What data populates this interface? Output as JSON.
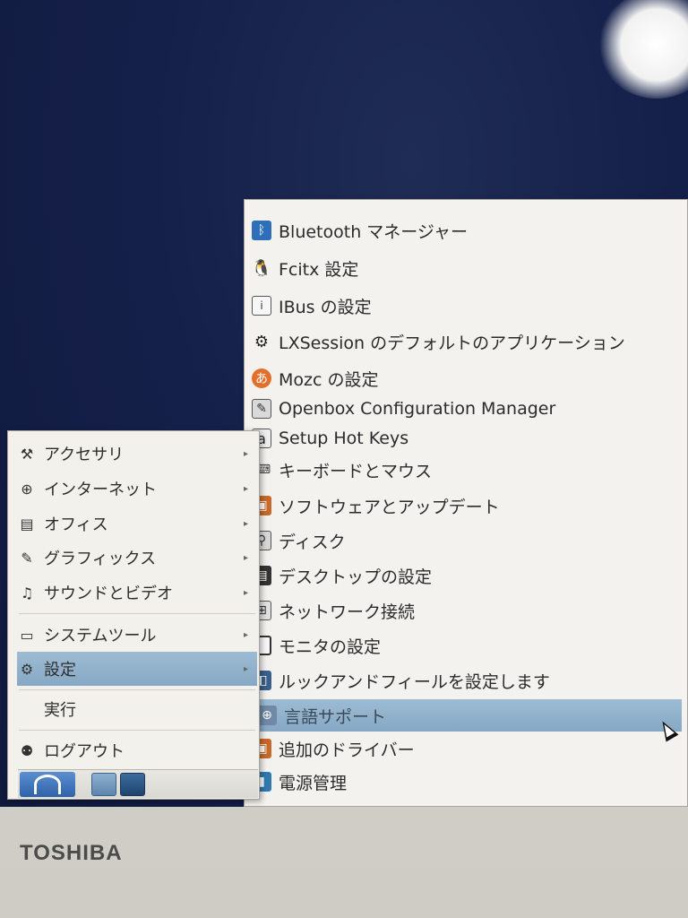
{
  "device": {
    "brand": "TOSHIBA"
  },
  "main_menu": {
    "items": [
      {
        "label": "アクセサリ",
        "icon": "accessories-icon",
        "has_submenu": true
      },
      {
        "label": "インターネット",
        "icon": "internet-globe-icon",
        "has_submenu": true
      },
      {
        "label": "オフィス",
        "icon": "office-document-icon",
        "has_submenu": true
      },
      {
        "label": "グラフィックス",
        "icon": "graphics-icon",
        "has_submenu": true
      },
      {
        "label": "サウンドとビデオ",
        "icon": "sound-video-icon",
        "has_submenu": true
      },
      {
        "label": "システムツール",
        "icon": "monitor-icon",
        "has_submenu": true
      },
      {
        "label": "設定",
        "icon": "gear-icon",
        "has_submenu": true,
        "selected": true
      },
      {
        "label": "実行",
        "icon": "",
        "has_submenu": false
      },
      {
        "label": "ログアウト",
        "icon": "logout-user-icon",
        "has_submenu": false
      }
    ],
    "submenu_arrow": "▸"
  },
  "settings_submenu": {
    "items": [
      {
        "label": "Bluetooth マネージャー",
        "icon": "bluetooth-icon"
      },
      {
        "label": "Fcitx 設定",
        "icon": "fcitx-penguin-icon"
      },
      {
        "label": "IBus の設定",
        "icon": "ibus-info-icon"
      },
      {
        "label": "LXSession のデフォルトのアプリケーション",
        "icon": "gear-icon"
      },
      {
        "label": "Mozc の設定",
        "icon": "mozc-icon"
      },
      {
        "label": "Openbox Configuration Manager",
        "icon": "openbox-icon"
      },
      {
        "label": "Setup Hot Keys",
        "icon": "hotkeys-icon"
      },
      {
        "label": "キーボードとマウス",
        "icon": "keyboard-icon"
      },
      {
        "label": "ソフトウェアとアップデート",
        "icon": "software-update-icon"
      },
      {
        "label": "ディスク",
        "icon": "disk-icon"
      },
      {
        "label": "デスクトップの設定",
        "icon": "desktop-icon"
      },
      {
        "label": "ネットワーク接続",
        "icon": "network-icon"
      },
      {
        "label": "モニタの設定",
        "icon": "monitor-icon"
      },
      {
        "label": "ルックアンドフィールを設定します",
        "icon": "look-and-feel-icon"
      },
      {
        "label": "言語サポート",
        "icon": "language-support-icon",
        "selected": true
      },
      {
        "label": "追加のドライバー",
        "icon": "additional-drivers-icon"
      },
      {
        "label": "電源管理",
        "icon": "power-management-icon"
      }
    ]
  },
  "colors": {
    "desktop_background": "#15204a",
    "menu_background": "#f2f1ec",
    "selection": "#8faecb"
  }
}
